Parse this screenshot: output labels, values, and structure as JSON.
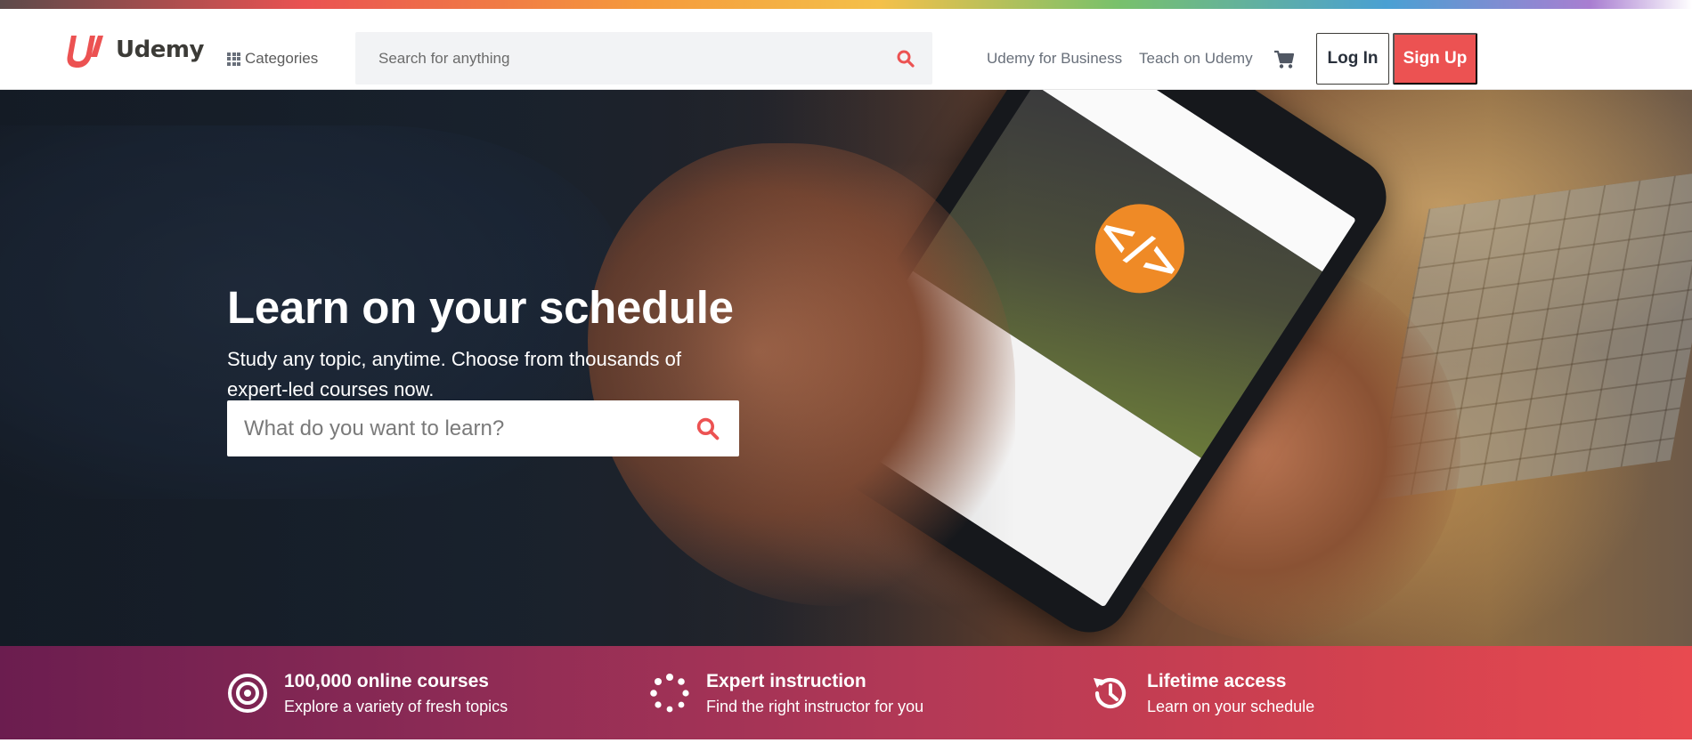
{
  "header": {
    "logo_text": "Udemy",
    "categories_label": "Categories",
    "search_placeholder": "Search for anything",
    "nav_links": [
      "Udemy for Business",
      "Teach on Udemy"
    ],
    "login_label": "Log In",
    "signup_label": "Sign Up"
  },
  "hero": {
    "title": "Learn on your schedule",
    "subtitle": "Study any topic, anytime. Choose from thousands of expert-led courses now.",
    "search_placeholder": "What do you want to learn?"
  },
  "value_props": [
    {
      "icon": "target-icon",
      "title": "100,000 online courses",
      "description": "Explore a variety of fresh topics"
    },
    {
      "icon": "spinner-icon",
      "title": "Expert instruction",
      "description": "Find the right instructor for you"
    },
    {
      "icon": "history-icon",
      "title": "Lifetime access",
      "description": "Learn on your schedule"
    }
  ],
  "colors": {
    "brand_red": "#ec5252",
    "text_dark": "#29303b",
    "nav_gray": "#686f7a",
    "strip_start": "#6b1d4f",
    "strip_end": "#e84a50"
  }
}
